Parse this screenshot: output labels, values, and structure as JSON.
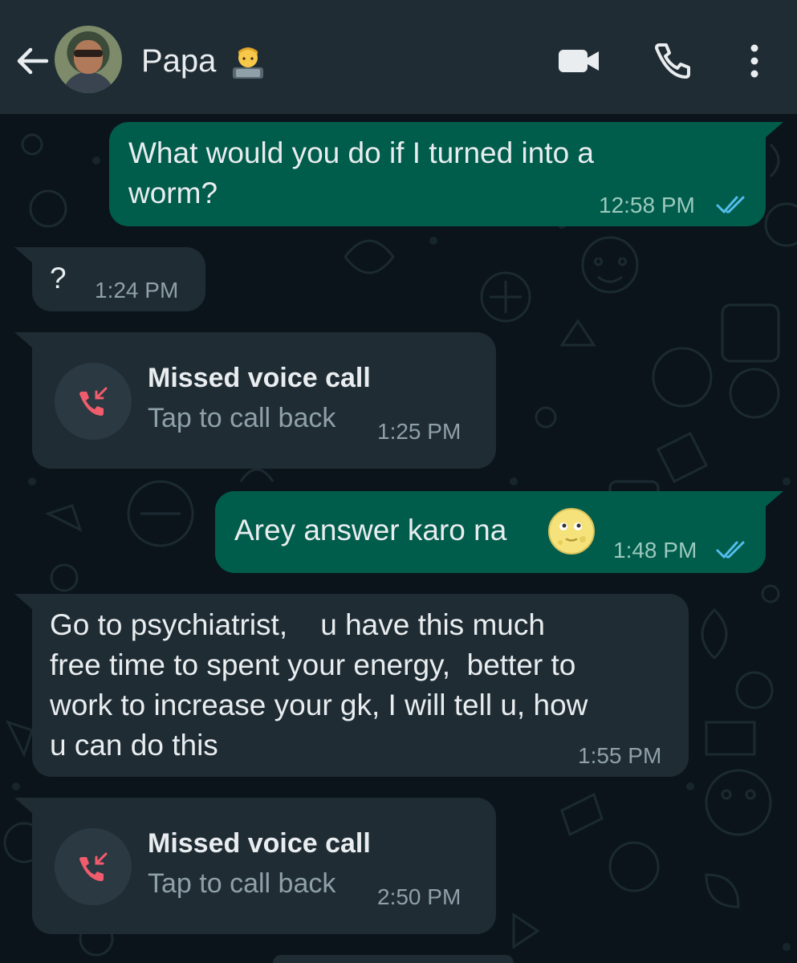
{
  "header": {
    "contact_name": "Papa",
    "icons": [
      "back-arrow-icon",
      "avatar",
      "technologist-emoji",
      "video-call-icon",
      "voice-call-icon",
      "more-options-icon"
    ]
  },
  "messages": [
    {
      "direction": "outgoing",
      "type": "text",
      "text": "What would you do if I turned into a\nworm?",
      "time": "12:58 PM",
      "status": "read"
    },
    {
      "direction": "incoming",
      "type": "text",
      "text": "?",
      "time": "1:24 PM"
    },
    {
      "direction": "incoming",
      "type": "missed_call",
      "title": "Missed voice call",
      "subtitle": "Tap to call back",
      "time": "1:25 PM"
    },
    {
      "direction": "outgoing",
      "type": "text",
      "text": "Arey answer karo na",
      "emoji": "full-moon-face-emoji",
      "time": "1:48 PM",
      "status": "read"
    },
    {
      "direction": "incoming",
      "type": "text",
      "text": "Go to psychiatrist,    u have this much\nfree time to spent your energy,  better to\nwork to increase your gk, I will tell u, how\nu can do this",
      "time": "1:55 PM"
    },
    {
      "direction": "incoming",
      "type": "missed_call",
      "title": "Missed voice call",
      "subtitle": "Tap to call back",
      "time": "2:50 PM"
    }
  ],
  "colors": {
    "header_bg": "#1f2c34",
    "chat_bg": "#0b141a",
    "outgoing_bubble": "#005c4b",
    "incoming_bubble": "#1f2c34",
    "read_ticks": "#53bdeb",
    "missed_call_red": "#f15c6d"
  }
}
